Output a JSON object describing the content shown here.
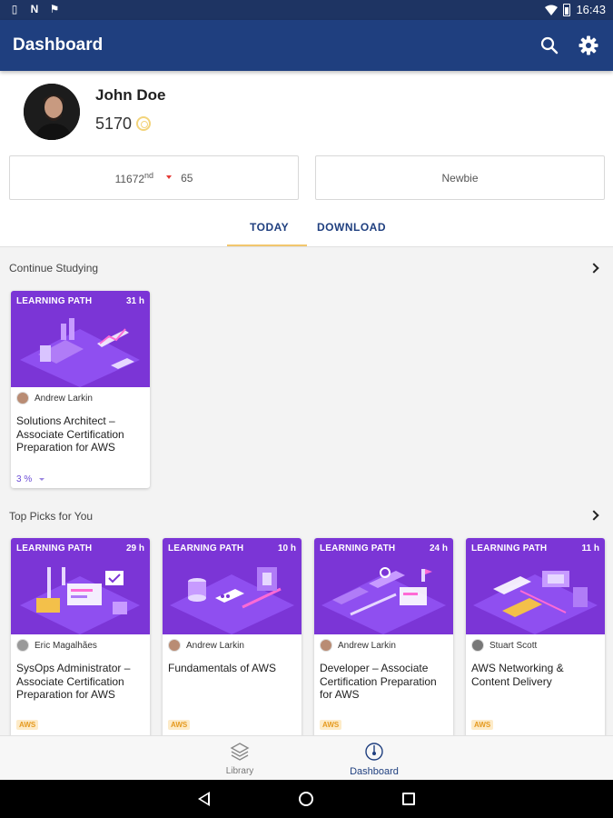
{
  "status_bar": {
    "time": "16:43",
    "left_icons": [
      "sim-icon",
      "notification-n-icon",
      "notification-flag-icon"
    ],
    "right_icons": [
      "wifi-icon",
      "battery-icon"
    ]
  },
  "app_bar": {
    "title": "Dashboard",
    "actions": [
      "search-icon",
      "settings-gear-icon"
    ]
  },
  "profile": {
    "name": "John Doe",
    "points": "5170",
    "points_icon": "coin-icon"
  },
  "stats": {
    "rank_number": "11672",
    "rank_suffix": "nd",
    "rank_change": "65",
    "rank_change_direction": "down",
    "level": "Newbie"
  },
  "tabs": [
    {
      "label": "TODAY",
      "selected": true
    },
    {
      "label": "DOWNLOAD",
      "selected": false
    }
  ],
  "continue_studying": {
    "title": "Continue Studying",
    "cards": [
      {
        "type": "LEARNING PATH",
        "hours": "31 h",
        "author": "Andrew Larkin",
        "title": "Solutions Architect – Associate Certification Preparation for AWS",
        "progress": "3 %"
      }
    ]
  },
  "top_picks": {
    "title": "Top Picks for You",
    "cards": [
      {
        "type": "LEARNING PATH",
        "hours": "29 h",
        "author": "Eric Magalhães",
        "title": "SysOps Administrator – Associate Certification Preparation for AWS",
        "tag": "AWS"
      },
      {
        "type": "LEARNING PATH",
        "hours": "10 h",
        "author": "Andrew Larkin",
        "title": "Fundamentals of AWS",
        "tag": "AWS"
      },
      {
        "type": "LEARNING PATH",
        "hours": "24 h",
        "author": "Andrew Larkin",
        "title": "Developer – Associate Certification Preparation for AWS",
        "tag": "AWS"
      },
      {
        "type": "LEARNING PATH",
        "hours": "11 h",
        "author": "Stuart Scott",
        "title": "AWS Networking & Content Delivery",
        "tag": "AWS"
      }
    ]
  },
  "bottom_nav": {
    "items": [
      {
        "label": "Library",
        "icon": "library-layers-icon",
        "selected": false
      },
      {
        "label": "Dashboard",
        "icon": "dashboard-gauge-icon",
        "selected": true
      }
    ]
  },
  "colors": {
    "status_bar": "#1e3463",
    "app_bar": "#1f3f7f",
    "card_banner": "#7b35d6",
    "tab_indicator": "#f2c66d",
    "tag_text": "#e59a1f"
  }
}
